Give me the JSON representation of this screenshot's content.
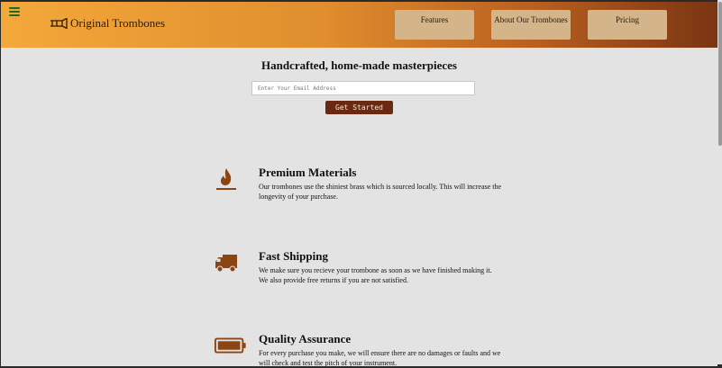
{
  "header": {
    "logo_text": "Original Trombones",
    "nav": [
      {
        "label": "Features"
      },
      {
        "label": "About Our Trombones"
      },
      {
        "label": "Pricing"
      }
    ]
  },
  "hero": {
    "title": "Handcrafted, home-made masterpieces",
    "email_placeholder": "Enter Your Email Address",
    "cta_label": "Get Started"
  },
  "features": [
    {
      "icon": "fire-icon",
      "title": "Premium Materials",
      "description": "Our trombones use the shiniest brass which is sourced locally. This will increase the longevity of your purchase."
    },
    {
      "icon": "truck-icon",
      "title": "Fast Shipping",
      "description": "We make sure you recieve your trombone as soon as we have finished making it. We also provide free returns if you are not satisfied."
    },
    {
      "icon": "battery-icon",
      "title": "Quality Assurance",
      "description": "For every purchase you make, we will ensure there are no damages or faults and we will check and test the pitch of your instrument."
    }
  ],
  "colors": {
    "accent": "#8b4513",
    "cta_bg": "#6a2a12",
    "nav_button_bg": "#d4b489",
    "hamburger": "#1f6b1f"
  }
}
